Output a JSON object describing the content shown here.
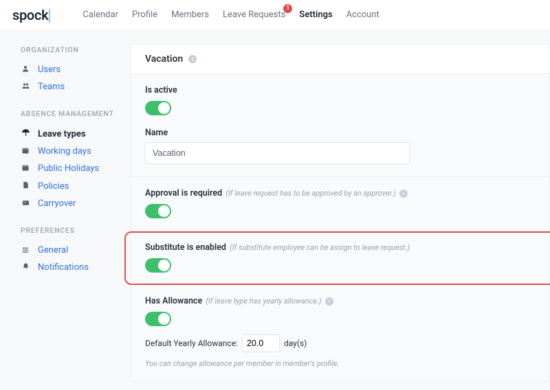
{
  "logo": "spock",
  "nav": {
    "calendar": "Calendar",
    "profile": "Profile",
    "members": "Members",
    "leave_requests": "Leave Requests",
    "leave_requests_badge": "1",
    "settings": "Settings",
    "account": "Account"
  },
  "sidebar": {
    "section_org": "ORGANIZATION",
    "users": "Users",
    "teams": "Teams",
    "section_absence": "ABSENCE MANAGEMENT",
    "leave_types": "Leave types",
    "working_days": "Working days",
    "public_holidays": "Public Holidays",
    "policies": "Policies",
    "carryover": "Carryover",
    "section_prefs": "PREFERENCES",
    "general": "General",
    "notifications": "Notifications"
  },
  "main": {
    "title": "Vacation",
    "is_active_label": "Is active",
    "name_label": "Name",
    "name_value": "Vacation",
    "approval_label": "Approval is required",
    "approval_hint": "(If leave request has to be approved by an approver.)",
    "substitute_label": "Substitute is enabled",
    "substitute_hint": "(If substitute employee can be assign to leave request.)",
    "allowance_label": "Has Allowance",
    "allowance_hint": "(If leave type has yearly allowance.)",
    "default_allowance_label": "Default Yearly Allowance:",
    "default_allowance_value": "20.0",
    "default_allowance_unit": "day(s)",
    "allowance_note": "You can change allowance per member in member's profile."
  }
}
